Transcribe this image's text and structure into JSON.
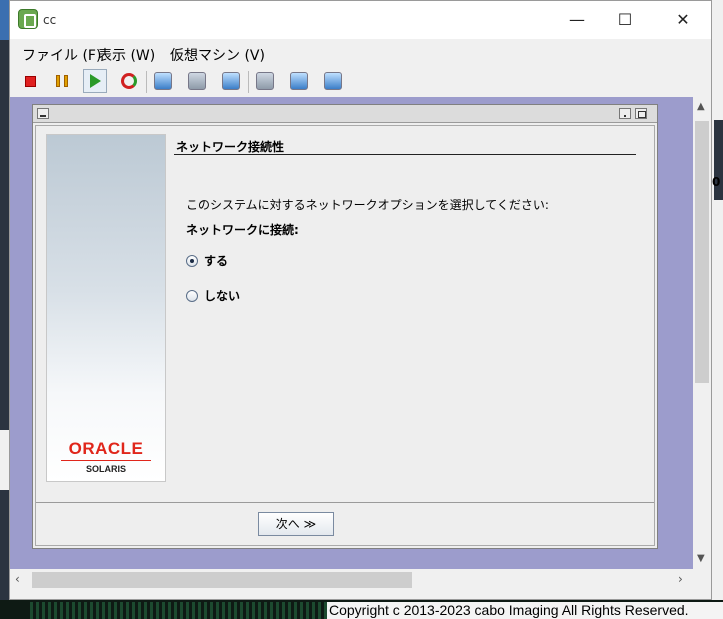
{
  "window": {
    "title": "cc",
    "minimize_glyph": "—",
    "maximize_glyph": "☐",
    "close_glyph": "✕"
  },
  "menu": [
    {
      "label": "ファイル (F)"
    },
    {
      "label": "表示 (W)"
    },
    {
      "label": "仮想マシン (V)"
    }
  ],
  "toolbar": {
    "icons": [
      "stop-icon",
      "pause-icon",
      "play-icon",
      "reset-icon",
      "snapshot-icon",
      "snapshot-restore-icon",
      "snapshot-manager-icon",
      "settings-icon",
      "media-icon",
      "tools-icon"
    ]
  },
  "installer": {
    "section_title": "ネットワーク接続性",
    "prompt": "このシステムに対するネットワークオプションを選択してください:",
    "connect_label": "ネットワークに接続:",
    "options": [
      {
        "label": "する",
        "selected": true
      },
      {
        "label": "しない",
        "selected": false
      }
    ],
    "next_button": "次へ ≫",
    "brand": {
      "oracle": "ORACLE",
      "solaris": "SOLARIS",
      "oracle_color": "#e0261b"
    }
  },
  "background": {
    "right_fragment": "0",
    "copyright": "Copyright c 2013-2023 cabo Imaging All Rights Reserved."
  }
}
